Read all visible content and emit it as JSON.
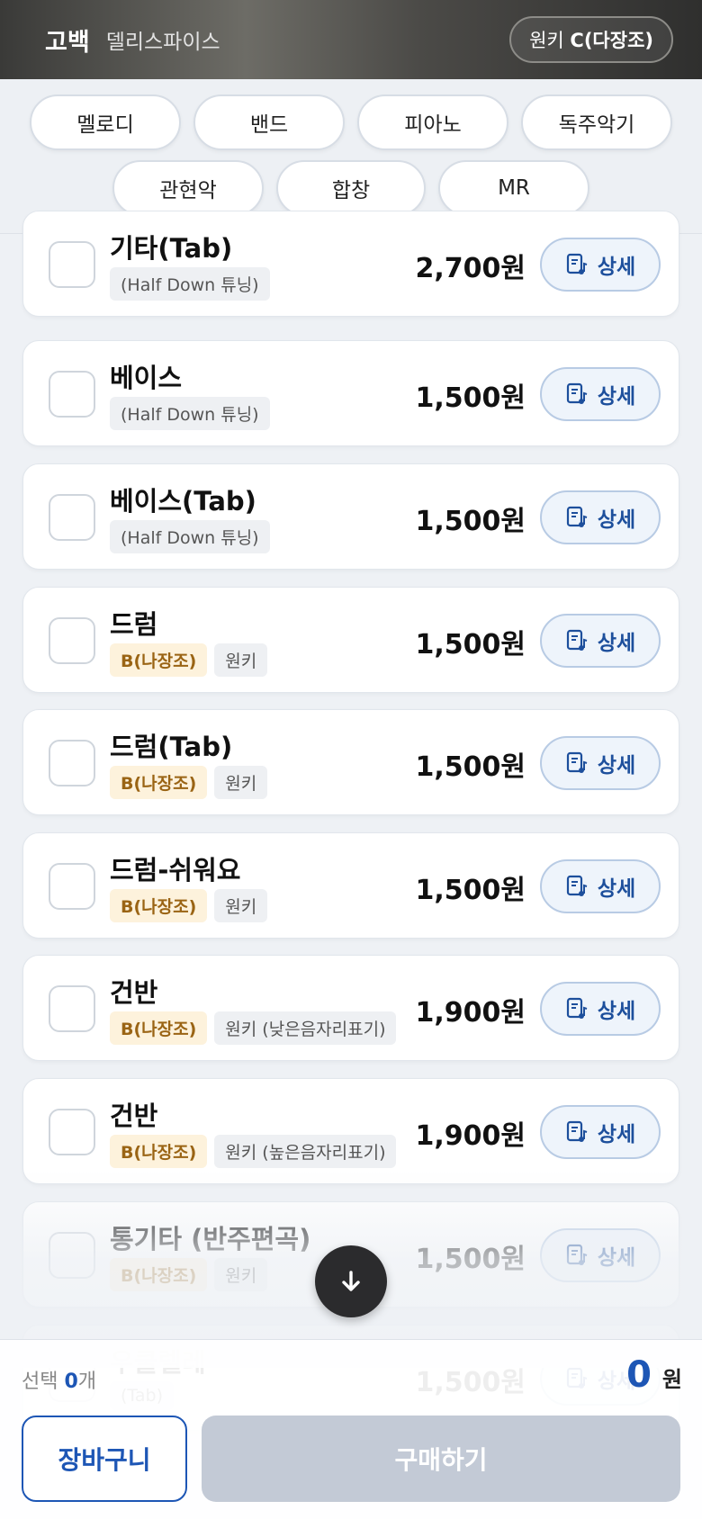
{
  "header": {
    "song_title": "고백",
    "artist": "델리스파이스",
    "key_label": "원키",
    "key_value": "C(다장조)"
  },
  "categories": [
    "멜로디",
    "밴드",
    "피아노",
    "독주악기",
    "관현악",
    "합창",
    "MR"
  ],
  "items": [
    {
      "name": "기타(Tab)",
      "tags": [
        {
          "text": "(Half Down 튜닝)",
          "type": "plain"
        }
      ],
      "price": "2,700원",
      "detail": "상세"
    },
    {
      "name": "베이스",
      "tags": [
        {
          "text": "(Half Down 튜닝)",
          "type": "plain"
        }
      ],
      "price": "1,500원",
      "detail": "상세"
    },
    {
      "name": "베이스(Tab)",
      "tags": [
        {
          "text": "(Half Down 튜닝)",
          "type": "plain"
        }
      ],
      "price": "1,500원",
      "detail": "상세"
    },
    {
      "name": "드럼",
      "tags": [
        {
          "text": "B(나장조)",
          "type": "key"
        },
        {
          "text": "원키",
          "type": "plain"
        }
      ],
      "price": "1,500원",
      "detail": "상세"
    },
    {
      "name": "드럼(Tab)",
      "tags": [
        {
          "text": "B(나장조)",
          "type": "key"
        },
        {
          "text": "원키",
          "type": "plain"
        }
      ],
      "price": "1,500원",
      "detail": "상세"
    },
    {
      "name": "드럼-쉬워요",
      "tags": [
        {
          "text": "B(나장조)",
          "type": "key"
        },
        {
          "text": "원키",
          "type": "plain"
        }
      ],
      "price": "1,500원",
      "detail": "상세"
    },
    {
      "name": "건반",
      "tags": [
        {
          "text": "B(나장조)",
          "type": "key"
        },
        {
          "text": "원키 (낮은음자리표기)",
          "type": "plain"
        }
      ],
      "price": "1,900원",
      "detail": "상세"
    },
    {
      "name": "건반",
      "tags": [
        {
          "text": "B(나장조)",
          "type": "key"
        },
        {
          "text": "원키 (높은음자리표기)",
          "type": "plain"
        }
      ],
      "price": "1,900원",
      "detail": "상세"
    },
    {
      "name": "통기타 (반주편곡)",
      "tags": [
        {
          "text": "B(나장조)",
          "type": "key"
        },
        {
          "text": "원키",
          "type": "plain"
        }
      ],
      "price": "1,500원",
      "detail": "상세"
    },
    {
      "name": "우쿨렐레",
      "tags": [
        {
          "text": "(Tab)",
          "type": "plain"
        }
      ],
      "price": "1,500원",
      "detail": "상세"
    }
  ],
  "footer": {
    "selected_prefix": "선택",
    "selected_count": "0",
    "selected_suffix": "개",
    "total_amount": "0",
    "total_unit": "원",
    "cart_label": "장바구니",
    "buy_label": "구매하기"
  },
  "colors": {
    "accent": "#1d56b5",
    "key_tag_bg": "#fdf2dc",
    "key_tag_text": "#9a6414",
    "buy_disabled": "#c3cad6"
  },
  "icons": {
    "detail": "sheet-music-icon",
    "scroll": "arrow-down-icon"
  }
}
